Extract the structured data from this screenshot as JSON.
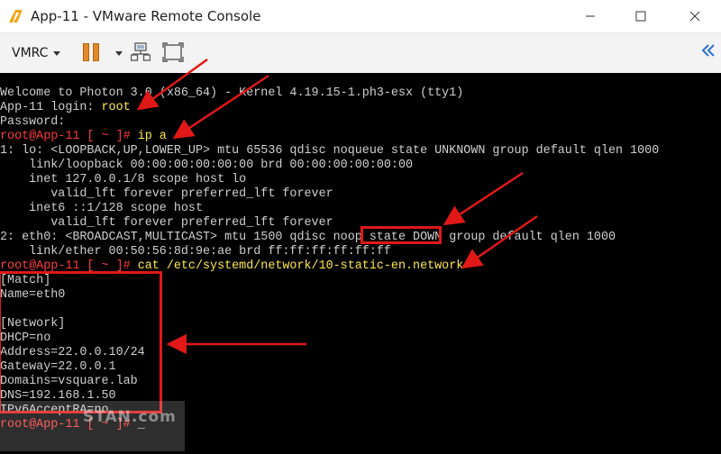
{
  "window": {
    "title": "App-11 - VMware Remote Console"
  },
  "toolbar": {
    "vmrc_label": "VMRC"
  },
  "watermark": {
    "text": "STAN.com"
  },
  "console": {
    "lines": [
      [
        {
          "t": "Welcome to Photon 3.0 (x86_64) - Kernel 4.19.15-1.ph3-esx (tty1)"
        }
      ],
      [
        {
          "t": "App-11 login: "
        },
        {
          "t": "root",
          "c": "yellow"
        }
      ],
      [
        {
          "t": "Password:"
        }
      ],
      [
        {
          "t": "root@App-11 [ ~ ]# ",
          "c": "red"
        },
        {
          "t": "ip a",
          "c": "yellow"
        }
      ],
      [
        {
          "t": "1: lo: <LOOPBACK,UP,LOWER_UP> mtu 65536 qdisc noqueue state UNKNOWN group default qlen 1000"
        }
      ],
      [
        {
          "t": "    link/loopback 00:00:00:00:00:00 brd 00:00:00:00:00:00"
        }
      ],
      [
        {
          "t": "    inet 127.0.0.1/8 scope host lo"
        }
      ],
      [
        {
          "t": "       valid_lft forever preferred_lft forever"
        }
      ],
      [
        {
          "t": "    inet6 ::1/128 scope host"
        }
      ],
      [
        {
          "t": "       valid_lft forever preferred_lft forever"
        }
      ],
      [
        {
          "t": "2: eth0: <BROADCAST,MULTICAST> mtu 1500 qdisc noop state DOWN group default qlen 1000"
        }
      ],
      [
        {
          "t": "    link/ether 00:50:56:8d:9e:ae brd ff:ff:ff:ff:ff:ff"
        }
      ],
      [
        {
          "t": "root@App-11 [ ~ ]# ",
          "c": "red"
        },
        {
          "t": "cat /etc/systemd/network/10-static-en.network",
          "c": "yellow"
        }
      ],
      [
        {
          "t": "[Match]"
        }
      ],
      [
        {
          "t": "Name=eth0"
        }
      ],
      [
        {
          "t": ""
        }
      ],
      [
        {
          "t": "[Network]"
        }
      ],
      [
        {
          "t": "DHCP=no"
        }
      ],
      [
        {
          "t": "Address=22.0.0.10/24"
        }
      ],
      [
        {
          "t": "Gateway=22.0.0.1"
        }
      ],
      [
        {
          "t": "Domains=vsquare.lab"
        }
      ],
      [
        {
          "t": "DNS=192.168.1.50"
        }
      ],
      [
        {
          "t": "IPv6AcceptRA=no"
        }
      ],
      [
        {
          "t": "root@App-11 [ ~ ]# ",
          "c": "red"
        },
        {
          "t": "_",
          "cursor": true
        }
      ]
    ]
  },
  "colors": {
    "prompt": "#ff3b3b",
    "command": "#ffe84a",
    "annotation": "#e01818",
    "accent": "#e08a2c"
  }
}
